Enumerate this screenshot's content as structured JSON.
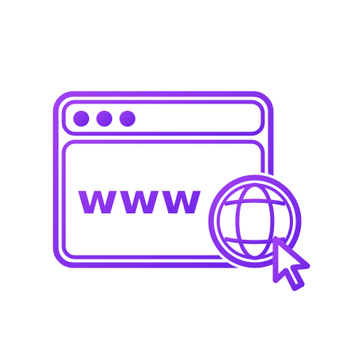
{
  "illustration": {
    "label": "www",
    "icon": "web-browser-globe-cursor-icon",
    "colors": {
      "gradient_start": "#9b3cf0",
      "gradient_end": "#6a1fe0"
    }
  }
}
